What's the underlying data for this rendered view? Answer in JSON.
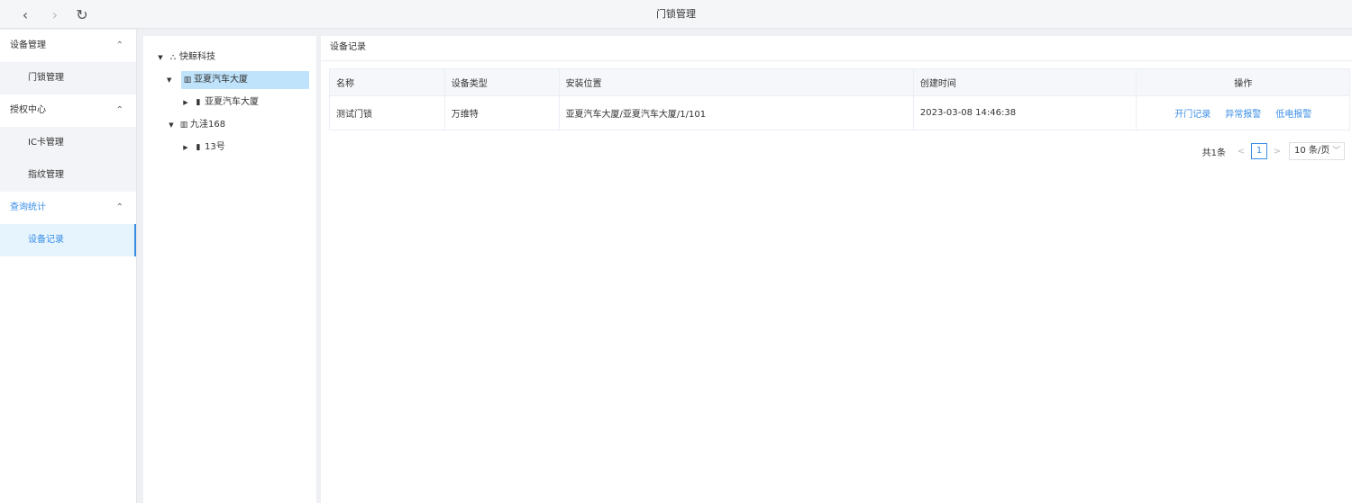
{
  "window": {
    "title": "门锁管理"
  },
  "nav": {
    "back": "‹",
    "forward": "›",
    "refresh": "↻"
  },
  "sidebar": {
    "groups": [
      {
        "label": "设备管理",
        "items": [
          "门锁管理"
        ]
      },
      {
        "label": "授权中心",
        "items": [
          "IC卡管理",
          "指纹管理"
        ]
      },
      {
        "label": "查询统计",
        "items": [
          "设备记录"
        ]
      }
    ],
    "chevron": "⌃"
  },
  "tree": {
    "root": "快鲸科技",
    "nodes": [
      {
        "label": "亚夏汽车大厦",
        "selected": true
      },
      {
        "label": "亚夏汽车大厦"
      },
      {
        "label": "九洼168"
      },
      {
        "label": "13号"
      }
    ]
  },
  "main": {
    "header": "设备记录",
    "columns": [
      "名称",
      "设备类型",
      "安装位置",
      "创建时间",
      "操作"
    ],
    "rows": [
      {
        "name": "测试门锁",
        "type": "万维特",
        "location": "亚夏汽车大厦/亚夏汽车大厦/1/101",
        "created": "2023-03-08 14:46:38"
      }
    ],
    "actions": [
      "开门记录",
      "异常报警",
      "低电报警"
    ],
    "pagination": {
      "total": "共1条",
      "prev": "<",
      "page": "1",
      "next": ">",
      "page_size": "10 条/页"
    }
  },
  "colors": {
    "accent": "#3a8ee6",
    "selected_tree": "#bfe3fb",
    "active_menu_bg": "#e6f4fd"
  },
  "icons": {
    "org": "sitemap-icon",
    "building": "building-icon"
  }
}
